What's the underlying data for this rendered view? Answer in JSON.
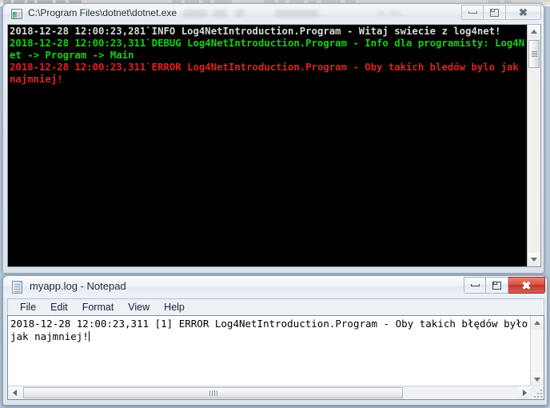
{
  "background_window": {
    "name": "partially-visible-background-window",
    "visible": true
  },
  "console_window": {
    "title": "C:\\Program Files\\dotnet\\dotnet.exe",
    "icon": "console-app-icon",
    "active": false,
    "buttons": {
      "minimize": "Minimize",
      "maximize": "Maximize",
      "close": "Close"
    },
    "colors": {
      "background": "#000000",
      "info_text": "#d8d8d8",
      "debug_text": "#12d212",
      "error_text": "#e32020"
    },
    "lines": [
      {
        "level": "INFO",
        "color_key": "info_text",
        "text": "2018-12-28 12:00:23,281`INFO Log4NetIntroduction.Program - Witaj swiecie z log4net!"
      },
      {
        "level": "DEBUG",
        "color_key": "debug_text",
        "text": "2018-12-28 12:00:23,311`DEBUG Log4NetIntroduction.Program - Info dla programisty: Log4Net -> Program -> Main"
      },
      {
        "level": "ERROR",
        "color_key": "error_text",
        "text": "2018-12-28 12:00:23,311`ERROR Log4NetIntroduction.Program - Oby takich bledów bylo jak najmniej!"
      }
    ],
    "scrollbar": {
      "up_arrow": "scroll-up",
      "down_arrow": "scroll-down",
      "thumb": "scroll-thumb"
    }
  },
  "notepad_window": {
    "title": "myapp.log - Notepad",
    "icon": "notepad-document-icon",
    "active": true,
    "buttons": {
      "minimize": "Minimize",
      "maximize": "Maximize",
      "close": "Close"
    },
    "menu": [
      {
        "label": "File"
      },
      {
        "label": "Edit"
      },
      {
        "label": "Format"
      },
      {
        "label": "View"
      },
      {
        "label": "Help"
      }
    ],
    "document_text": "2018-12-28 12:00:23,311 [1] ERROR Log4NetIntroduction.Program - Oby takich błędów było jak najmniej!",
    "caret_visible": true,
    "scrollbars": {
      "vertical": {
        "up_arrow": "scroll-up",
        "down_arrow": "scroll-down"
      },
      "horizontal": {
        "left_arrow": "scroll-left",
        "right_arrow": "scroll-right",
        "thumb": "h-scroll-thumb"
      },
      "resize_grip": "resize-grip"
    }
  }
}
